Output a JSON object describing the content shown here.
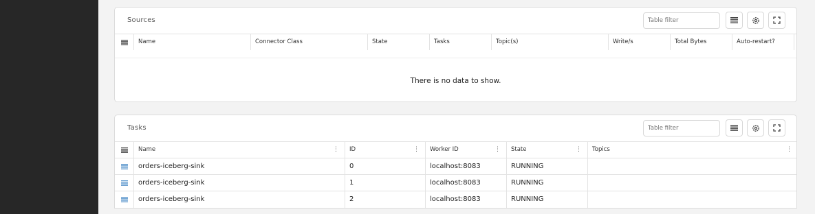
{
  "colors": {
    "sidebar": "#272727",
    "row_icon": "#4a8bc7"
  },
  "sources": {
    "title": "Sources",
    "filter_placeholder": "Table filter",
    "columns": [
      "Name",
      "Connector Class",
      "State",
      "Tasks",
      "Topic(s)",
      "Write/s",
      "Total Bytes",
      "Auto-restart?"
    ],
    "empty_message": "There is no data to show."
  },
  "tasks": {
    "title": "Tasks",
    "filter_placeholder": "Table filter",
    "columns": [
      "Name",
      "ID",
      "Worker ID",
      "State",
      "Topics"
    ],
    "rows": [
      {
        "name": "orders-iceberg-sink",
        "id": "0",
        "worker": "localhost:8083",
        "state": "RUNNING",
        "topics": ""
      },
      {
        "name": "orders-iceberg-sink",
        "id": "1",
        "worker": "localhost:8083",
        "state": "RUNNING",
        "topics": ""
      },
      {
        "name": "orders-iceberg-sink",
        "id": "2",
        "worker": "localhost:8083",
        "state": "RUNNING",
        "topics": ""
      }
    ]
  },
  "icons": {
    "menu": "list-icon",
    "settings": "gear-icon",
    "fullscreen": "expand-icon",
    "row": "row-menu-icon"
  }
}
